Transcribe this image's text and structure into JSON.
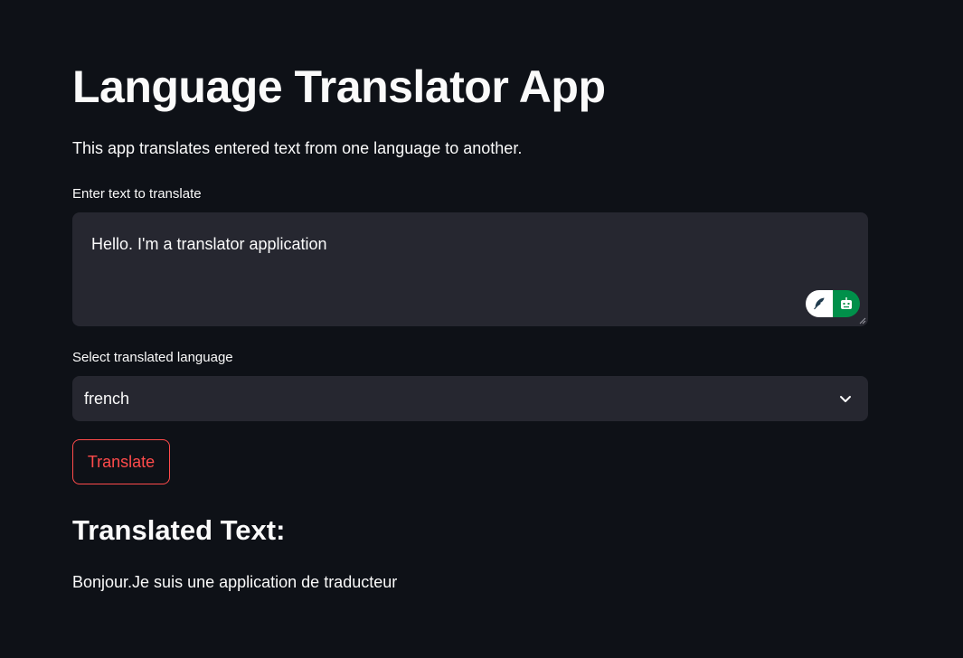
{
  "app": {
    "title": "Language Translator App",
    "description": "This app translates entered text from one language to another."
  },
  "input": {
    "label": "Enter text to translate",
    "value": "Hello. I'm a translator application"
  },
  "extensions": {
    "left_icon": "feather-icon",
    "right_icon": "robot-icon",
    "right_color": "#00904a"
  },
  "language_select": {
    "label": "Select translated language",
    "selected": "french"
  },
  "translate_button": {
    "label": "Translate",
    "accent": "#ff4b4b"
  },
  "output": {
    "header": "Translated Text:",
    "text": "Bonjour.Je suis une application de traducteur"
  },
  "theme": {
    "background": "#0e1117",
    "input_background": "#262730",
    "text": "#fafafa"
  }
}
